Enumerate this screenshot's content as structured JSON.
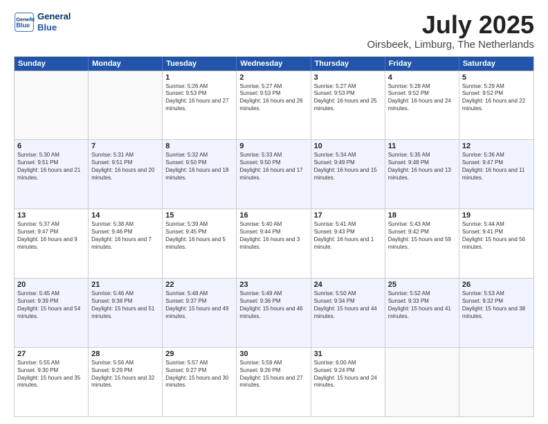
{
  "header": {
    "logo_line1": "General",
    "logo_line2": "Blue",
    "month_year": "July 2025",
    "location": "Oirsbeek, Limburg, The Netherlands"
  },
  "days_of_week": [
    "Sunday",
    "Monday",
    "Tuesday",
    "Wednesday",
    "Thursday",
    "Friday",
    "Saturday"
  ],
  "rows": [
    [
      {
        "day": "",
        "sunrise": "",
        "sunset": "",
        "daylight": "",
        "empty": true
      },
      {
        "day": "",
        "sunrise": "",
        "sunset": "",
        "daylight": "",
        "empty": true
      },
      {
        "day": "1",
        "sunrise": "Sunrise: 5:26 AM",
        "sunset": "Sunset: 9:53 PM",
        "daylight": "Daylight: 16 hours and 27 minutes."
      },
      {
        "day": "2",
        "sunrise": "Sunrise: 5:27 AM",
        "sunset": "Sunset: 9:53 PM",
        "daylight": "Daylight: 16 hours and 26 minutes."
      },
      {
        "day": "3",
        "sunrise": "Sunrise: 5:27 AM",
        "sunset": "Sunset: 9:53 PM",
        "daylight": "Daylight: 16 hours and 25 minutes."
      },
      {
        "day": "4",
        "sunrise": "Sunrise: 5:28 AM",
        "sunset": "Sunset: 9:52 PM",
        "daylight": "Daylight: 16 hours and 24 minutes."
      },
      {
        "day": "5",
        "sunrise": "Sunrise: 5:29 AM",
        "sunset": "Sunset: 9:52 PM",
        "daylight": "Daylight: 16 hours and 22 minutes."
      }
    ],
    [
      {
        "day": "6",
        "sunrise": "Sunrise: 5:30 AM",
        "sunset": "Sunset: 9:51 PM",
        "daylight": "Daylight: 16 hours and 21 minutes."
      },
      {
        "day": "7",
        "sunrise": "Sunrise: 5:31 AM",
        "sunset": "Sunset: 9:51 PM",
        "daylight": "Daylight: 16 hours and 20 minutes."
      },
      {
        "day": "8",
        "sunrise": "Sunrise: 5:32 AM",
        "sunset": "Sunset: 9:50 PM",
        "daylight": "Daylight: 16 hours and 18 minutes."
      },
      {
        "day": "9",
        "sunrise": "Sunrise: 5:33 AM",
        "sunset": "Sunset: 9:50 PM",
        "daylight": "Daylight: 16 hours and 17 minutes."
      },
      {
        "day": "10",
        "sunrise": "Sunrise: 5:34 AM",
        "sunset": "Sunset: 9:49 PM",
        "daylight": "Daylight: 16 hours and 15 minutes."
      },
      {
        "day": "11",
        "sunrise": "Sunrise: 5:35 AM",
        "sunset": "Sunset: 9:48 PM",
        "daylight": "Daylight: 16 hours and 13 minutes."
      },
      {
        "day": "12",
        "sunrise": "Sunrise: 5:36 AM",
        "sunset": "Sunset: 9:47 PM",
        "daylight": "Daylight: 16 hours and 11 minutes."
      }
    ],
    [
      {
        "day": "13",
        "sunrise": "Sunrise: 5:37 AM",
        "sunset": "Sunset: 9:47 PM",
        "daylight": "Daylight: 16 hours and 9 minutes."
      },
      {
        "day": "14",
        "sunrise": "Sunrise: 5:38 AM",
        "sunset": "Sunset: 9:46 PM",
        "daylight": "Daylight: 16 hours and 7 minutes."
      },
      {
        "day": "15",
        "sunrise": "Sunrise: 5:39 AM",
        "sunset": "Sunset: 9:45 PM",
        "daylight": "Daylight: 16 hours and 5 minutes."
      },
      {
        "day": "16",
        "sunrise": "Sunrise: 5:40 AM",
        "sunset": "Sunset: 9:44 PM",
        "daylight": "Daylight: 16 hours and 3 minutes."
      },
      {
        "day": "17",
        "sunrise": "Sunrise: 5:41 AM",
        "sunset": "Sunset: 9:43 PM",
        "daylight": "Daylight: 16 hours and 1 minute."
      },
      {
        "day": "18",
        "sunrise": "Sunrise: 5:43 AM",
        "sunset": "Sunset: 9:42 PM",
        "daylight": "Daylight: 15 hours and 59 minutes."
      },
      {
        "day": "19",
        "sunrise": "Sunrise: 5:44 AM",
        "sunset": "Sunset: 9:41 PM",
        "daylight": "Daylight: 15 hours and 56 minutes."
      }
    ],
    [
      {
        "day": "20",
        "sunrise": "Sunrise: 5:45 AM",
        "sunset": "Sunset: 9:39 PM",
        "daylight": "Daylight: 15 hours and 54 minutes."
      },
      {
        "day": "21",
        "sunrise": "Sunrise: 5:46 AM",
        "sunset": "Sunset: 9:38 PM",
        "daylight": "Daylight: 15 hours and 51 minutes."
      },
      {
        "day": "22",
        "sunrise": "Sunrise: 5:48 AM",
        "sunset": "Sunset: 9:37 PM",
        "daylight": "Daylight: 15 hours and 49 minutes."
      },
      {
        "day": "23",
        "sunrise": "Sunrise: 5:49 AM",
        "sunset": "Sunset: 9:36 PM",
        "daylight": "Daylight: 15 hours and 46 minutes."
      },
      {
        "day": "24",
        "sunrise": "Sunrise: 5:50 AM",
        "sunset": "Sunset: 9:34 PM",
        "daylight": "Daylight: 15 hours and 44 minutes."
      },
      {
        "day": "25",
        "sunrise": "Sunrise: 5:52 AM",
        "sunset": "Sunset: 9:33 PM",
        "daylight": "Daylight: 15 hours and 41 minutes."
      },
      {
        "day": "26",
        "sunrise": "Sunrise: 5:53 AM",
        "sunset": "Sunset: 9:32 PM",
        "daylight": "Daylight: 15 hours and 38 minutes."
      }
    ],
    [
      {
        "day": "27",
        "sunrise": "Sunrise: 5:55 AM",
        "sunset": "Sunset: 9:30 PM",
        "daylight": "Daylight: 15 hours and 35 minutes."
      },
      {
        "day": "28",
        "sunrise": "Sunrise: 5:56 AM",
        "sunset": "Sunset: 9:29 PM",
        "daylight": "Daylight: 15 hours and 32 minutes."
      },
      {
        "day": "29",
        "sunrise": "Sunrise: 5:57 AM",
        "sunset": "Sunset: 9:27 PM",
        "daylight": "Daylight: 15 hours and 30 minutes."
      },
      {
        "day": "30",
        "sunrise": "Sunrise: 5:59 AM",
        "sunset": "Sunset: 9:26 PM",
        "daylight": "Daylight: 15 hours and 27 minutes."
      },
      {
        "day": "31",
        "sunrise": "Sunrise: 6:00 AM",
        "sunset": "Sunset: 9:24 PM",
        "daylight": "Daylight: 15 hours and 24 minutes."
      },
      {
        "day": "",
        "sunrise": "",
        "sunset": "",
        "daylight": "",
        "empty": true
      },
      {
        "day": "",
        "sunrise": "",
        "sunset": "",
        "daylight": "",
        "empty": true
      }
    ]
  ],
  "alt_rows": [
    1,
    3
  ]
}
